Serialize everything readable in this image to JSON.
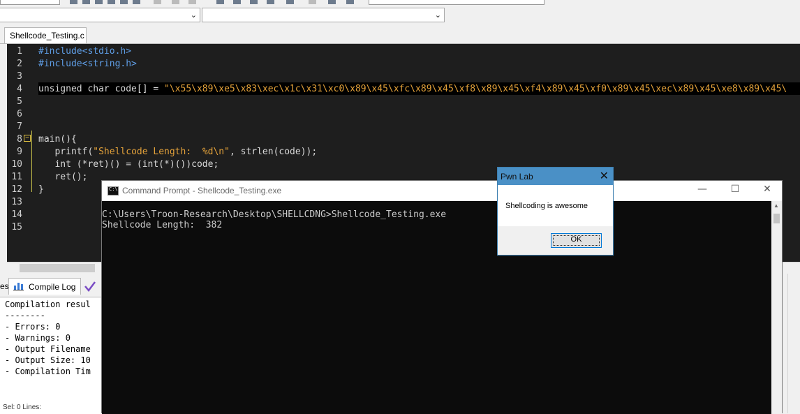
{
  "editor": {
    "tab_label": "Shellcode_Testing.c",
    "lines": [
      {
        "n": "1",
        "segments": [
          {
            "t": "#include<stdio.h>",
            "c": "inc"
          }
        ]
      },
      {
        "n": "2",
        "segments": [
          {
            "t": "#include<string.h>",
            "c": "inc"
          }
        ]
      },
      {
        "n": "3",
        "segments": []
      },
      {
        "n": "4",
        "segments": [
          {
            "t": "unsigned char code[] = ",
            "c": "kw"
          },
          {
            "t": "\"\\x55\\x89\\xe5\\x83\\xec\\x1c\\x31\\xc0\\x89\\x45\\xfc\\x89\\x45\\xf8\\x89\\x45\\xf4\\x89\\x45\\xf0\\x89\\x45\\xec\\x89\\x45\\xe8\\x89\\x45\\",
            "c": "str"
          }
        ]
      },
      {
        "n": "5",
        "segments": []
      },
      {
        "n": "6",
        "segments": []
      },
      {
        "n": "7",
        "segments": []
      },
      {
        "n": "8",
        "segments": [
          {
            "t": "main(){",
            "c": "kw"
          }
        ]
      },
      {
        "n": "9",
        "segments": [
          {
            "t": "   printf(",
            "c": "kw"
          },
          {
            "t": "\"Shellcode Length:  %d\\n\"",
            "c": "str"
          },
          {
            "t": ", strlen(code));",
            "c": "kw"
          }
        ]
      },
      {
        "n": "10",
        "segments": [
          {
            "t": "   int (*ret)() = (int(*)())code;",
            "c": "kw"
          }
        ]
      },
      {
        "n": "11",
        "segments": [
          {
            "t": "   ret();",
            "c": "kw"
          }
        ]
      },
      {
        "n": "12",
        "segments": [
          {
            "t": "}",
            "c": "kw"
          }
        ]
      },
      {
        "n": "13",
        "segments": []
      },
      {
        "n": "14",
        "segments": []
      },
      {
        "n": "15",
        "segments": []
      }
    ]
  },
  "bottom_panel": {
    "left_tab_fragment": "es",
    "compile_log_tab": "Compile Log",
    "log_lines": [
      "Compilation resul",
      "--------",
      "- Errors: 0",
      "- Warnings: 0",
      "- Output Filename",
      "- Output Size: 10",
      "- Compilation Tim"
    ],
    "status_fragment": "Sel:   0      Lines:"
  },
  "cmd_window": {
    "title": "Command Prompt - Shellcode_Testing.exe",
    "icon_text": "C:\\",
    "lines": [
      "C:\\Users\\Troon-Research\\Desktop\\SHELLCDNG>Shellcode_Testing.exe",
      "Shellcode Length:  382"
    ],
    "minimize": "—",
    "maximize": "☐",
    "close": "✕"
  },
  "message_box": {
    "title": "Pwn Lab",
    "message": "Shellcoding is awesome",
    "ok_label": "OK",
    "close": "✕"
  },
  "colors": {
    "editor_bg": "#1e1e1e",
    "include": "#5f9ee6",
    "string": "#e4a23a",
    "msg_titlebar": "#4a90c6",
    "cmd_bg": "#0c0c0c"
  }
}
